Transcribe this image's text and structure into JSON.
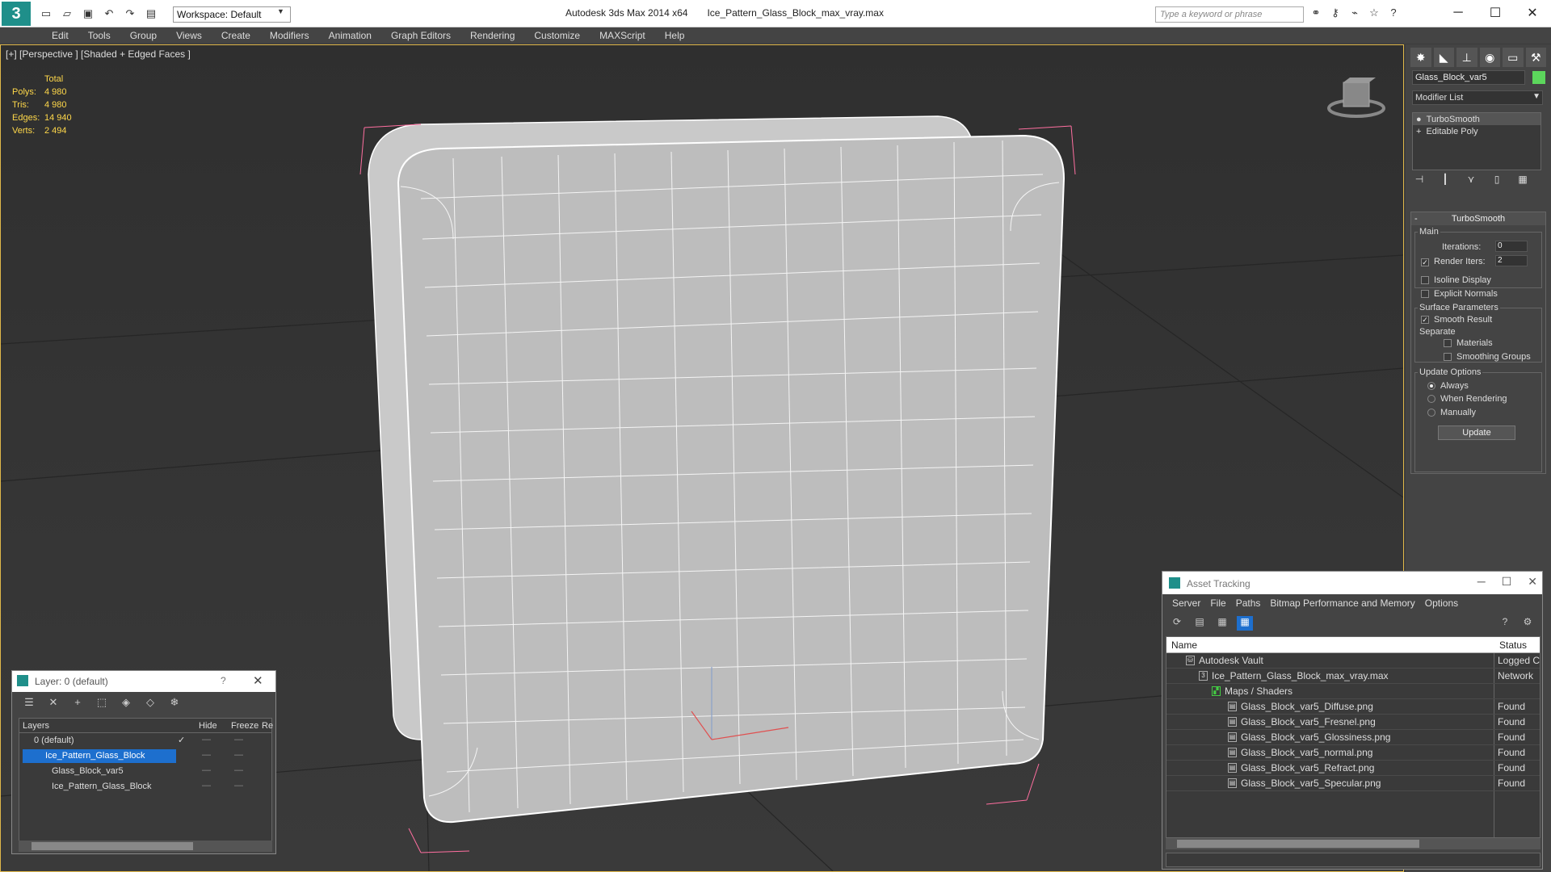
{
  "titlebar": {
    "app": "Autodesk 3ds Max  2014 x64",
    "file": "Ice_Pattern_Glass_Block_max_vray.max",
    "workspace": "Workspace: Default",
    "search_placeholder": "Type a keyword or phrase",
    "logo": "3"
  },
  "menu": [
    "Edit",
    "Tools",
    "Group",
    "Views",
    "Create",
    "Modifiers",
    "Animation",
    "Graph Editors",
    "Rendering",
    "Customize",
    "MAXScript",
    "Help"
  ],
  "viewport": {
    "label": "[+] [Perspective ] [Shaded + Edged Faces ]",
    "stats": {
      "header": "Total",
      "rows": [
        {
          "k": "Polys:",
          "v": "4 980"
        },
        {
          "k": "Tris:",
          "v": "4 980"
        },
        {
          "k": "Edges:",
          "v": "14 940"
        },
        {
          "k": "Verts:",
          "v": "2 494"
        }
      ]
    }
  },
  "command_panel": {
    "object_name": "Glass_Block_var5",
    "object_color": "#5cd65c",
    "modifier_list": "Modifier List",
    "stack": [
      "TurboSmooth",
      "Editable Poly"
    ],
    "rollout": {
      "title": "TurboSmooth",
      "main": "Main",
      "iterations_label": "Iterations:",
      "iterations": "0",
      "render_iters_label": "Render Iters:",
      "render_iters": "2",
      "render_iters_checked": true,
      "isoline": "Isoline Display",
      "explicit_normals": "Explicit Normals",
      "surface_params": "Surface Parameters",
      "smooth_result": "Smooth Result",
      "separate": "Separate",
      "materials": "Materials",
      "smoothing_groups": "Smoothing Groups",
      "update_options": "Update Options",
      "always": "Always",
      "when_rendering": "When Rendering",
      "manually": "Manually",
      "update_btn": "Update"
    }
  },
  "layer_window": {
    "title": "Layer: 0 (default)",
    "help": "?",
    "columns": {
      "layers": "Layers",
      "hide": "Hide",
      "freeze": "Freeze",
      "render": "Re"
    },
    "rows": [
      {
        "name": "0 (default)",
        "indent": 0
      },
      {
        "name": "Ice_Pattern_Glass_Block",
        "indent": 0,
        "selected": true
      },
      {
        "name": "Glass_Block_var5",
        "indent": 1
      },
      {
        "name": "Ice_Pattern_Glass_Block",
        "indent": 1
      }
    ]
  },
  "asset_tracking": {
    "title": "Asset Tracking",
    "menu": [
      "Server",
      "File",
      "Paths",
      "Bitmap Performance and Memory",
      "Options"
    ],
    "columns": {
      "name": "Name",
      "status": "Status"
    },
    "rows": [
      {
        "name": "Autodesk Vault",
        "status": "Logged C",
        "indent": 1
      },
      {
        "name": "Ice_Pattern_Glass_Block_max_vray.max",
        "status": "Network",
        "indent": 2
      },
      {
        "name": "Maps / Shaders",
        "status": "",
        "indent": 3
      },
      {
        "name": "Glass_Block_var5_Diffuse.png",
        "status": "Found",
        "indent": 4
      },
      {
        "name": "Glass_Block_var5_Fresnel.png",
        "status": "Found",
        "indent": 4
      },
      {
        "name": "Glass_Block_var5_Glossiness.png",
        "status": "Found",
        "indent": 4
      },
      {
        "name": "Glass_Block_var5_normal.png",
        "status": "Found",
        "indent": 4
      },
      {
        "name": "Glass_Block_var5_Refract.png",
        "status": "Found",
        "indent": 4
      },
      {
        "name": "Glass_Block_var5_Specular.png",
        "status": "Found",
        "indent": 4
      }
    ]
  }
}
